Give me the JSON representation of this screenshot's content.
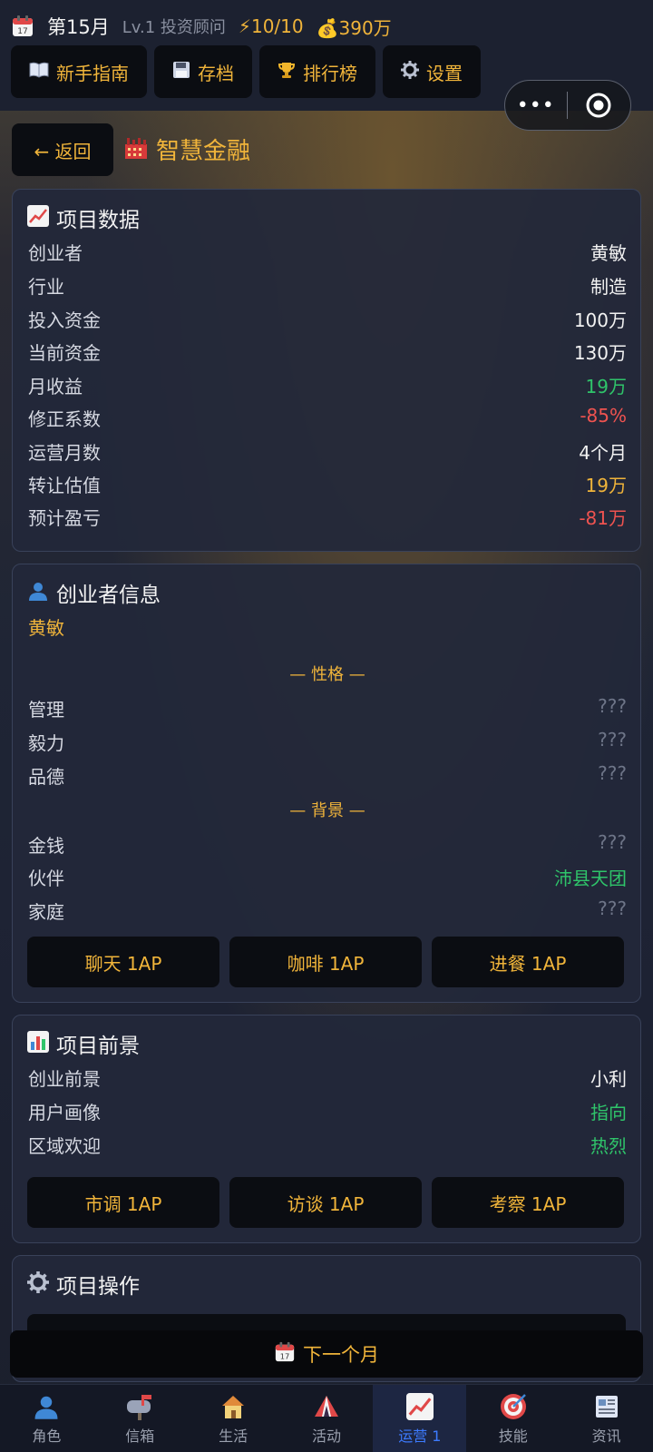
{
  "status": {
    "month": "第15月",
    "level": "Lv.1 投资顾问",
    "energy": "⚡10/10",
    "money": "💰390万"
  },
  "nav": [
    {
      "label": "新手指南",
      "icon": "book-icon"
    },
    {
      "label": "存档",
      "icon": "save-icon"
    },
    {
      "label": "排行榜",
      "icon": "trophy-icon"
    },
    {
      "label": "设置",
      "icon": "gear-icon"
    }
  ],
  "capsule": {
    "more": "•••"
  },
  "back_label": "← 返回",
  "project_title": "智慧金融",
  "project_data": {
    "title": "项目数据",
    "rows": [
      {
        "k": "创业者",
        "v": "黄敏"
      },
      {
        "k": "行业",
        "v": "制造"
      },
      {
        "k": "投入资金",
        "v": "100万"
      },
      {
        "k": "当前资金",
        "v": "130万"
      },
      {
        "k": "月收益",
        "v": "19万"
      },
      {
        "k": "修正系数",
        "v": "-85%"
      },
      {
        "k": "运营月数",
        "v": "4个月"
      },
      {
        "k": "转让估值",
        "v": "19万"
      },
      {
        "k": "预计盈亏",
        "v": "-81万"
      }
    ]
  },
  "founder": {
    "title": "创业者信息",
    "name": "黄敏",
    "personality_label": "— 性格 —",
    "personality": [
      {
        "k": "管理",
        "v": "???"
      },
      {
        "k": "毅力",
        "v": "???"
      },
      {
        "k": "品德",
        "v": "???"
      }
    ],
    "background_label": "— 背景 —",
    "background": [
      {
        "k": "金钱",
        "v": "???"
      },
      {
        "k": "伙伴",
        "v": "沛县天团"
      },
      {
        "k": "家庭",
        "v": "???"
      }
    ],
    "actions": [
      "聊天 1AP",
      "咖啡 1AP",
      "进餐 1AP"
    ]
  },
  "outlook": {
    "title": "项目前景",
    "rows": [
      {
        "k": "创业前景",
        "v": "小利"
      },
      {
        "k": "用户画像",
        "v": "指向"
      },
      {
        "k": "区域欢迎",
        "v": "热烈"
      }
    ],
    "actions": [
      "市调 1AP",
      "访谈 1AP",
      "考察 1AP"
    ]
  },
  "operations": {
    "title": "项目操作"
  },
  "next_month": "下一个月",
  "tabs": [
    {
      "label": "角色",
      "icon": "person-icon"
    },
    {
      "label": "信箱",
      "icon": "mailbox-icon"
    },
    {
      "label": "生活",
      "icon": "house-icon"
    },
    {
      "label": "活动",
      "icon": "tent-icon"
    },
    {
      "label": "运营 1",
      "icon": "chart-icon",
      "active": true
    },
    {
      "label": "技能",
      "icon": "target-icon"
    },
    {
      "label": "资讯",
      "icon": "newspaper-icon"
    }
  ],
  "colors": {
    "accent": "#f0b43a",
    "positive": "#2fc46a",
    "negative": "#ef5350",
    "active_tab": "#3d7bff"
  }
}
